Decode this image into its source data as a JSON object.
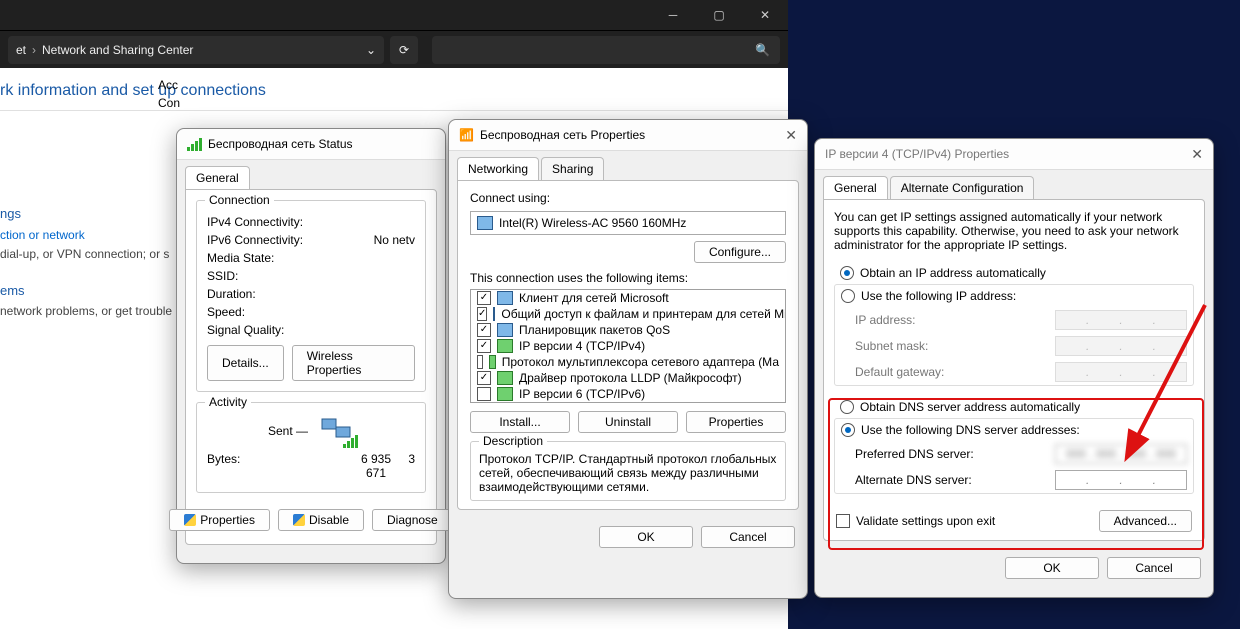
{
  "cp": {
    "breadcrumb": [
      "et",
      "Network and Sharing Center"
    ],
    "heading": "rk information and set up connections",
    "right_labels": [
      "Acc",
      "Con"
    ],
    "sidebar": {
      "settings_hdr": "ngs",
      "conn_link": "ction or network",
      "conn_desc": "dial-up, or VPN connection; or s",
      "problems_hdr": "ems",
      "problems_desc": "network problems, or get trouble"
    }
  },
  "status": {
    "title": "Беспроводная сеть Status",
    "tab_general": "General",
    "group_connection": "Connection",
    "rows": {
      "ipv4": "IPv4 Connectivity:",
      "ipv6": "IPv6 Connectivity:",
      "ipv6_val": "No netv",
      "media": "Media State:",
      "ssid": "SSID:",
      "duration": "Duration:",
      "speed": "Speed:",
      "signal_quality": "Signal Quality:"
    },
    "btn_details": "Details...",
    "btn_wireless": "Wireless Properties",
    "group_activity": "Activity",
    "sent_label": "Sent  —",
    "bytes_label": "Bytes:",
    "bytes_sent": "6 935 671",
    "btn_properties": "Properties",
    "btn_disable": "Disable",
    "btn_diagnose": "Diagnose"
  },
  "prop": {
    "title": "Беспроводная сеть Properties",
    "tab_networking": "Networking",
    "tab_sharing": "Sharing",
    "connect_using": "Connect using:",
    "adapter": "Intel(R) Wireless-AC 9560 160MHz",
    "btn_configure": "Configure...",
    "items_label": "This connection uses the following items:",
    "items": [
      {
        "chk": true,
        "kind": "nic",
        "label": "Клиент для сетей Microsoft"
      },
      {
        "chk": true,
        "kind": "nic",
        "label": "Общий доступ к файлам и принтерам для сетей Mi"
      },
      {
        "chk": true,
        "kind": "nic",
        "label": "Планировщик пакетов QoS"
      },
      {
        "chk": true,
        "kind": "proto",
        "label": "IP версии 4 (TCP/IPv4)"
      },
      {
        "chk": false,
        "kind": "proto",
        "label": "Протокол мультиплексора сетевого адаптера (Ма"
      },
      {
        "chk": true,
        "kind": "proto",
        "label": "Драйвер протокола LLDP (Майкрософт)"
      },
      {
        "chk": false,
        "kind": "proto",
        "label": "IP версии 6 (TCP/IPv6)"
      }
    ],
    "btn_install": "Install...",
    "btn_uninstall": "Uninstall",
    "btn_item_props": "Properties",
    "group_desc": "Description",
    "desc_text": "Протокол TCP/IP. Стандартный протокол глобальных сетей, обеспечивающий связь между различными взаимодействующими сетями.",
    "btn_ok": "OK",
    "btn_cancel": "Cancel"
  },
  "ipv4": {
    "title": "IP версии 4 (TCP/IPv4) Properties",
    "tab_general": "General",
    "tab_alt": "Alternate Configuration",
    "intro": "You can get IP settings assigned automatically if your network supports this capability. Otherwise, you need to ask your network administrator for the appropriate IP settings.",
    "r_obtain_ip": "Obtain an IP address automatically",
    "r_use_ip": "Use the following IP address:",
    "f_ip": "IP address:",
    "f_mask": "Subnet mask:",
    "f_gw": "Default gateway:",
    "r_obtain_dns": "Obtain DNS server address automatically",
    "r_use_dns": "Use the following DNS server addresses:",
    "f_pref_dns": "Preferred DNS server:",
    "f_alt_dns": "Alternate DNS server:",
    "chk_validate": "Validate settings upon exit",
    "btn_advanced": "Advanced...",
    "btn_ok": "OK",
    "btn_cancel": "Cancel"
  }
}
